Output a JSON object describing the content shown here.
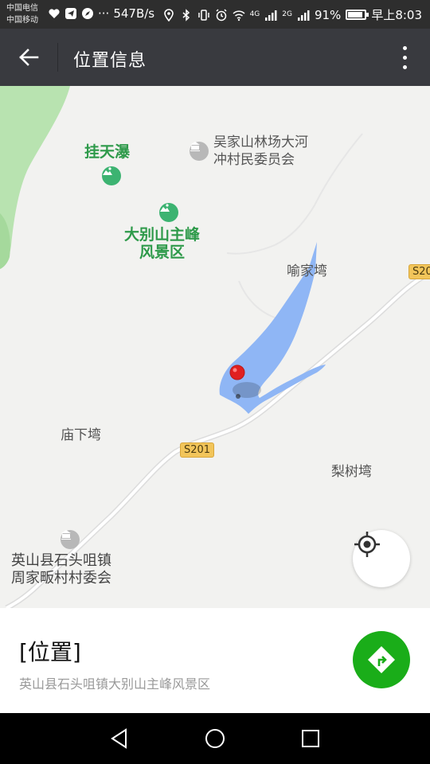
{
  "status_bar": {
    "carrier1": "中国电信",
    "carrier2": "中国移动",
    "speed": "547B/s",
    "battery": "91%",
    "time": "早上8:03",
    "signal1": "4G",
    "signal2": "2G",
    "battery_level": 0.91
  },
  "header": {
    "title": "位置信息"
  },
  "map": {
    "labels": {
      "guatianpu": "挂天瀑",
      "wujiashan_line1": "吴家山林场大河",
      "wujiashan_line2": "冲村民委员会",
      "dabieshan_line1": "大别山主峰",
      "dabieshan_line2": "风景区",
      "yujiawan": "喻家塆",
      "miaoxiawan": "庙下塆",
      "lishuwan": "梨树塆",
      "yingshan_line1": "英山县石头咀镇",
      "yingshan_line2": "周家畈村村委会"
    },
    "roads": {
      "s201": "S201",
      "s20_edge": "S20"
    },
    "colors": {
      "land": "#f2f2f0",
      "water": "#8fb6f5",
      "forest": "#b8e3b0",
      "road": "#ffffff",
      "marker": "#e02020"
    }
  },
  "location": {
    "title": "[位置]",
    "address": "英山县石头咀镇大别山主峰风景区"
  },
  "colors": {
    "app_bar": "#393a3f",
    "status_bar": "#2e2e2e",
    "nav_button": "#1aad19"
  }
}
